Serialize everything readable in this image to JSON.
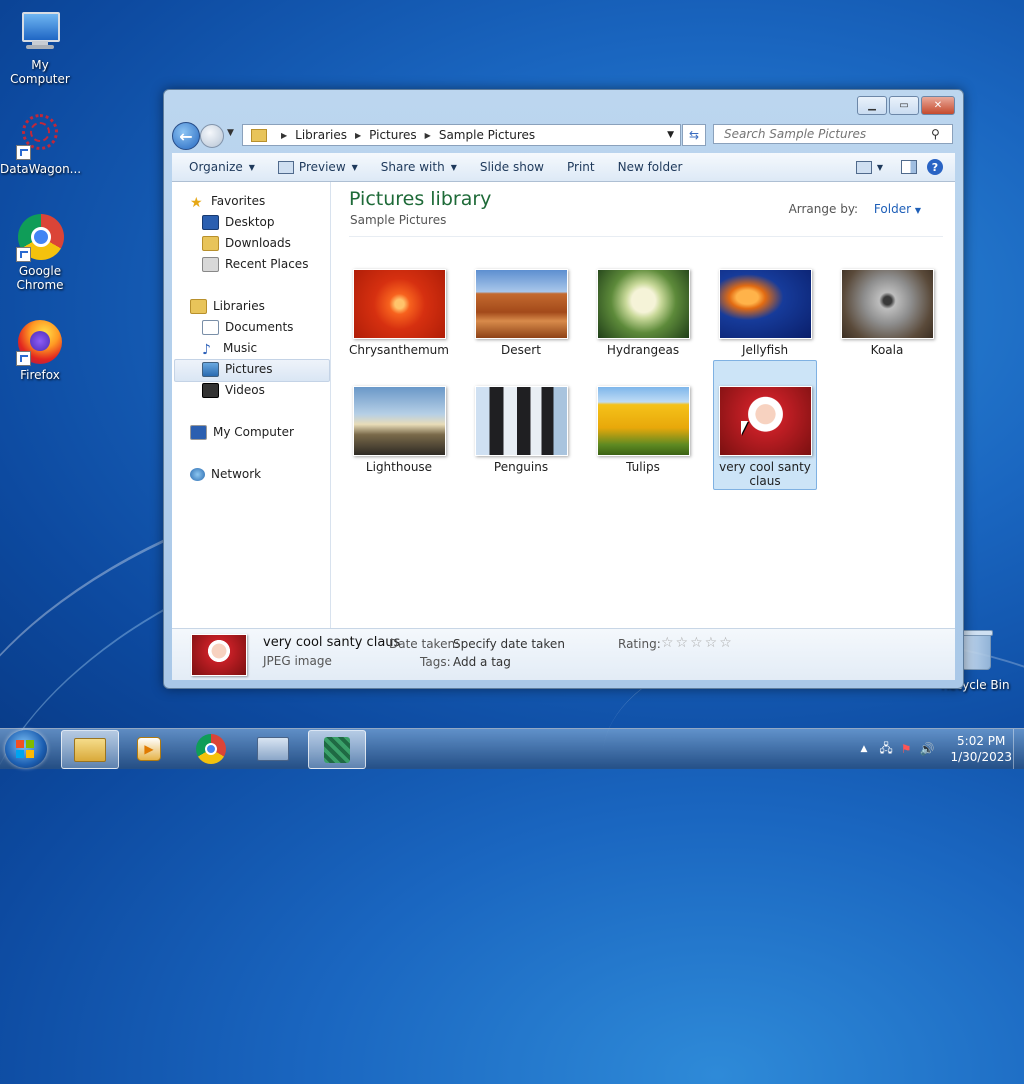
{
  "desktop": {
    "icons": [
      {
        "label": "My Computer"
      },
      {
        "label": "DataWagon..."
      },
      {
        "label": "Google Chrome"
      },
      {
        "label": "Firefox"
      },
      {
        "label": "Recycle Bin"
      }
    ]
  },
  "window": {
    "address": {
      "crumbs": [
        "Libraries",
        "Pictures",
        "Sample Pictures"
      ]
    },
    "search": {
      "placeholder": "Search Sample Pictures"
    },
    "toolbar": {
      "organize": "Organize",
      "preview": "Preview",
      "share_with": "Share with",
      "slide_show": "Slide show",
      "print": "Print",
      "new_folder": "New folder"
    },
    "nav": {
      "favorites": "Favorites",
      "desktop": "Desktop",
      "downloads": "Downloads",
      "recent_places": "Recent Places",
      "libraries": "Libraries",
      "documents": "Documents",
      "music": "Music",
      "pictures": "Pictures",
      "videos": "Videos",
      "my_computer": "My Computer",
      "network": "Network"
    },
    "library": {
      "title": "Pictures library",
      "subtitle": "Sample Pictures",
      "arrange_label": "Arrange by:",
      "arrange_value": "Folder"
    },
    "files": [
      {
        "name": "Chrysanthemum"
      },
      {
        "name": "Desert"
      },
      {
        "name": "Hydrangeas"
      },
      {
        "name": "Jellyfish"
      },
      {
        "name": "Koala"
      },
      {
        "name": "Lighthouse"
      },
      {
        "name": "Penguins"
      },
      {
        "name": "Tulips"
      },
      {
        "name": "very cool santy claus"
      }
    ],
    "details": {
      "name": "very cool santy claus",
      "type": "JPEG image",
      "date_label": "Date taken:",
      "date_value": "Specify date taken",
      "tags_label": "Tags:",
      "tags_value": "Add a tag",
      "rating_label": "Rating:",
      "rating_stars": "☆☆☆☆☆"
    }
  },
  "taskbar": {
    "time": "5:02 PM",
    "date": "1/30/2023"
  }
}
